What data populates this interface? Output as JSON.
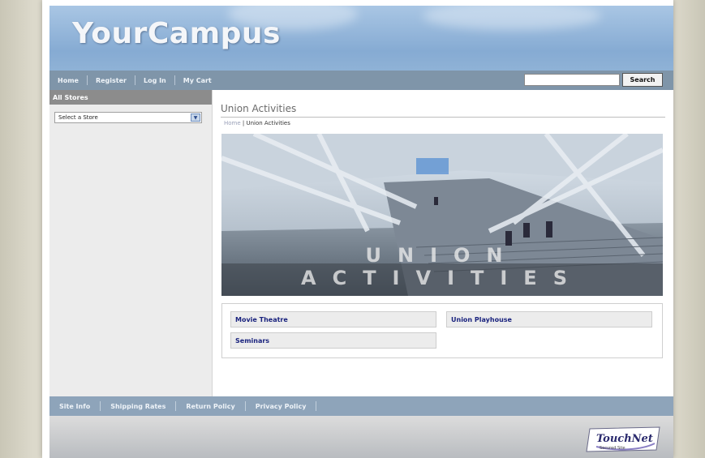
{
  "header": {
    "logo": "YourCampus"
  },
  "nav": {
    "items": [
      "Home",
      "Register",
      "Log In",
      "My Cart"
    ]
  },
  "search": {
    "placeholder": "",
    "button_label": "Search"
  },
  "sidebar": {
    "heading": "All Stores",
    "store_select": "Select a Store"
  },
  "main": {
    "title": "Union Activities",
    "breadcrumb": {
      "home": "Home",
      "separator": " | ",
      "current": "Union Activities"
    },
    "banner_text": "UNION ACTIVITIES",
    "links": [
      "Movie Theatre",
      "Union Playhouse",
      "Seminars"
    ]
  },
  "footer": {
    "items": [
      "Site Info",
      "Shipping Rates",
      "Return Policy",
      "Privacy Policy"
    ],
    "badge": {
      "brand": "TouchNet",
      "tagline": "Secured Site"
    }
  },
  "colors": {
    "nav": "#7f95a9",
    "link": "#1a237e",
    "header_sky": "#86abd3"
  }
}
